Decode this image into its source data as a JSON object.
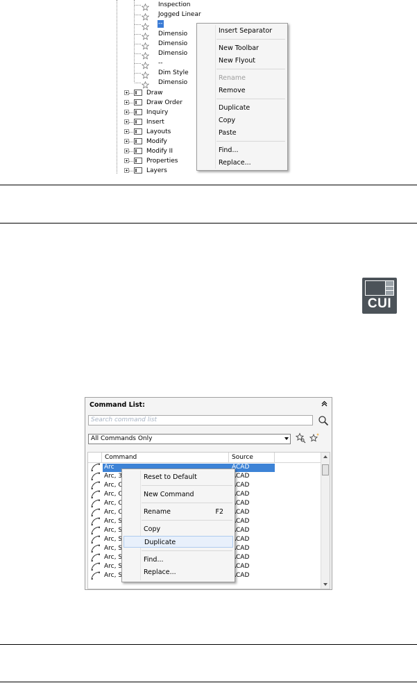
{
  "tree": {
    "children": [
      {
        "label": "Inspection"
      },
      {
        "label": "Jogged Linear"
      },
      {
        "label": "--"
      },
      {
        "label": "Dimensio"
      },
      {
        "label": "Dimensio"
      },
      {
        "label": "Dimensio"
      },
      {
        "label": "--"
      },
      {
        "label": "Dim Style"
      },
      {
        "label": "Dimensio"
      }
    ],
    "toolbars": [
      {
        "label": "Draw"
      },
      {
        "label": "Draw Order"
      },
      {
        "label": "Inquiry"
      },
      {
        "label": "Insert"
      },
      {
        "label": "Layouts"
      },
      {
        "label": "Modify"
      },
      {
        "label": "Modify II"
      },
      {
        "label": "Properties"
      },
      {
        "label": "Layers"
      }
    ]
  },
  "tree_menu": {
    "items": [
      {
        "label": "Insert Separator",
        "disabled": false
      },
      {
        "label": "New Toolbar",
        "disabled": false
      },
      {
        "label": "New Flyout",
        "disabled": false
      },
      {
        "label": "Rename",
        "disabled": true
      },
      {
        "label": "Remove",
        "disabled": false
      },
      {
        "label": "Duplicate",
        "disabled": false
      },
      {
        "label": "Copy",
        "disabled": false
      },
      {
        "label": "Paste",
        "disabled": false
      },
      {
        "label": "Find...",
        "disabled": false
      },
      {
        "label": "Replace...",
        "disabled": false
      }
    ]
  },
  "cui_icon": {
    "text": "CUI"
  },
  "command_list": {
    "title": "Command List:",
    "search_placeholder": "Search command list",
    "filter_value": "All Commands Only",
    "columns": {
      "command": "Command",
      "source": "Source"
    },
    "rows": [
      {
        "command": "Arc",
        "source": "ACAD"
      },
      {
        "command": "Arc, 3",
        "source": "ACAD"
      },
      {
        "command": "Arc, C",
        "source": "ACAD"
      },
      {
        "command": "Arc, C",
        "source": "ACAD"
      },
      {
        "command": "Arc, C",
        "source": "ACAD"
      },
      {
        "command": "Arc, C",
        "source": "ACAD"
      },
      {
        "command": "Arc, S",
        "source": "ACAD"
      },
      {
        "command": "Arc, S",
        "source": "ACAD"
      },
      {
        "command": "Arc, S",
        "source": "ACAD"
      },
      {
        "command": "Arc, S",
        "source": "ACAD"
      },
      {
        "command": "Arc, S",
        "source": "ACAD"
      },
      {
        "command": "Arc, S",
        "source": "ACAD"
      },
      {
        "command": "Arc, S",
        "source": "ACAD"
      }
    ]
  },
  "list_menu": {
    "items": [
      {
        "label": "Reset to Default",
        "shortcut": ""
      },
      {
        "label": "New Command",
        "shortcut": ""
      },
      {
        "label": "Rename",
        "shortcut": "F2"
      },
      {
        "label": "Copy",
        "shortcut": ""
      },
      {
        "label": "Duplicate",
        "shortcut": ""
      },
      {
        "label": "Find...",
        "shortcut": ""
      },
      {
        "label": "Replace...",
        "shortcut": ""
      }
    ]
  }
}
